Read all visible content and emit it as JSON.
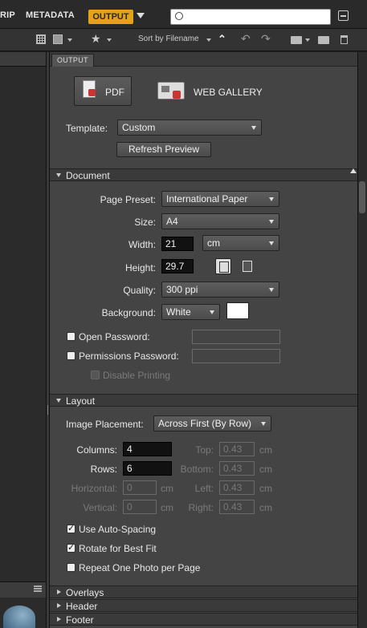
{
  "workspace": {
    "modules": [
      "RIP",
      "METADATA",
      "OUTPUT"
    ],
    "active": "OUTPUT",
    "search_value": "",
    "accent_color": "#e3a21a"
  },
  "toolbar": {
    "sort_label": "Sort by Filename",
    "icons": [
      "thumbnail-grid-icon",
      "view-mode-icon",
      "star-rating-icon",
      "ascending-sort-icon",
      "rotate-left-icon",
      "rotate-right-icon",
      "open-folder-icon",
      "new-folder-icon",
      "trash-icon"
    ]
  },
  "panel": {
    "tab": "OUTPUT",
    "pdf_label": "PDF",
    "web_label": "WEB GALLERY",
    "template_label": "Template:",
    "template_value": "Custom",
    "refresh_label": "Refresh Preview"
  },
  "document": {
    "title": "Document",
    "page_preset_label": "Page Preset:",
    "page_preset_value": "International Paper",
    "size_label": "Size:",
    "size_value": "A4",
    "width_label": "Width:",
    "width_value": "21",
    "unit_value": "cm",
    "height_label": "Height:",
    "height_value": "29.7",
    "quality_label": "Quality:",
    "quality_value": "300 ppi",
    "background_label": "Background:",
    "background_value": "White",
    "background_color": "#ffffff",
    "open_password_label": "Open Password:",
    "permissions_password_label": "Permissions Password:",
    "disable_printing_label": "Disable Printing"
  },
  "layout": {
    "title": "Layout",
    "placement_label": "Image Placement:",
    "placement_value": "Across First (By Row)",
    "columns_label": "Columns:",
    "columns_value": "4",
    "rows_label": "Rows:",
    "rows_value": "6",
    "horizontal_label": "Horizontal:",
    "horizontal_value": "0",
    "vertical_label": "Vertical:",
    "vertical_value": "0",
    "top_label": "Top:",
    "top_value": "0.43",
    "bottom_label": "Bottom:",
    "bottom_value": "0.43",
    "left_label": "Left:",
    "left_value": "0.43",
    "right_label": "Right:",
    "right_value": "0.43",
    "unit": "cm",
    "auto_spacing_label": "Use Auto-Spacing",
    "auto_spacing_checked": true,
    "rotate_label": "Rotate for Best Fit",
    "rotate_checked": true,
    "repeat_label": "Repeat One Photo per Page",
    "repeat_checked": false
  },
  "collapsed_sections": [
    "Overlays",
    "Header",
    "Footer"
  ]
}
